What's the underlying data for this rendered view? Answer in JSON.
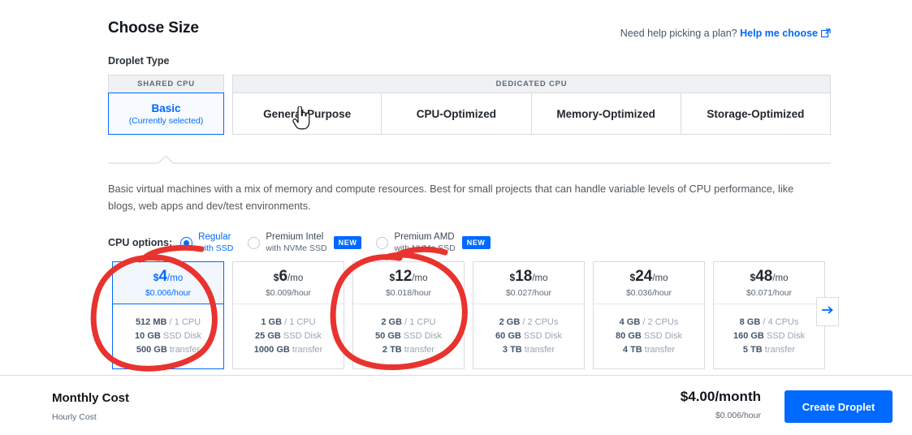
{
  "header": {
    "title": "Choose Size",
    "help_prefix": "Need help picking a plan?",
    "help_link": "Help me choose",
    "external_link_icon": "external-link-icon"
  },
  "droplet_type": {
    "label": "Droplet Type",
    "groups": [
      {
        "group_label": "SHARED CPU",
        "tabs": [
          {
            "label": "Basic",
            "sublabel": "(Currently selected)",
            "selected": true
          }
        ]
      },
      {
        "group_label": "DEDICATED CPU",
        "tabs": [
          {
            "label": "General Purpose",
            "sublabel": "",
            "selected": false
          },
          {
            "label": "CPU-Optimized",
            "sublabel": "",
            "selected": false
          },
          {
            "label": "Memory-Optimized",
            "sublabel": "",
            "selected": false
          },
          {
            "label": "Storage-Optimized",
            "sublabel": "",
            "selected": false
          }
        ]
      }
    ]
  },
  "description": "Basic virtual machines with a mix of memory and compute resources. Best for small projects that can handle variable levels of CPU performance, like blogs, web apps and dev/test environments.",
  "cpu_options": {
    "label": "CPU options:",
    "options": [
      {
        "title": "Regular",
        "subtitle": "with SSD",
        "selected": true,
        "badge": ""
      },
      {
        "title": "Premium Intel",
        "subtitle": "with NVMe SSD",
        "selected": false,
        "badge": "NEW"
      },
      {
        "title": "Premium AMD",
        "subtitle": "with NVMe SSD",
        "selected": false,
        "badge": "NEW"
      }
    ]
  },
  "plans": [
    {
      "price": "4",
      "currency": "$",
      "per": "/mo",
      "hourly": "$0.006/hour",
      "memory": "512 MB",
      "cpu": "1 CPU",
      "disk": "10 GB",
      "disk_label": "SSD Disk",
      "transfer": "500 GB",
      "transfer_label": "transfer",
      "selected": true
    },
    {
      "price": "6",
      "currency": "$",
      "per": "/mo",
      "hourly": "$0.009/hour",
      "memory": "1 GB",
      "cpu": "1 CPU",
      "disk": "25 GB",
      "disk_label": "SSD Disk",
      "transfer": "1000 GB",
      "transfer_label": "transfer",
      "selected": false
    },
    {
      "price": "12",
      "currency": "$",
      "per": "/mo",
      "hourly": "$0.018/hour",
      "memory": "2 GB",
      "cpu": "1 CPU",
      "disk": "50 GB",
      "disk_label": "SSD Disk",
      "transfer": "2 TB",
      "transfer_label": "transfer",
      "selected": false
    },
    {
      "price": "18",
      "currency": "$",
      "per": "/mo",
      "hourly": "$0.027/hour",
      "memory": "2 GB",
      "cpu": "2 CPUs",
      "disk": "60 GB",
      "disk_label": "SSD Disk",
      "transfer": "3 TB",
      "transfer_label": "transfer",
      "selected": false
    },
    {
      "price": "24",
      "currency": "$",
      "per": "/mo",
      "hourly": "$0.036/hour",
      "memory": "4 GB",
      "cpu": "2 CPUs",
      "disk": "80 GB",
      "disk_label": "SSD Disk",
      "transfer": "4 TB",
      "transfer_label": "transfer",
      "selected": false
    },
    {
      "price": "48",
      "currency": "$",
      "per": "/mo",
      "hourly": "$0.071/hour",
      "memory": "8 GB",
      "cpu": "4 CPUs",
      "disk": "160 GB",
      "disk_label": "SSD Disk",
      "transfer": "5 TB",
      "transfer_label": "transfer",
      "selected": false
    }
  ],
  "next_button_icon": "arrow-right-icon",
  "footer": {
    "monthly_label": "Monthly Cost",
    "hourly_label": "Hourly Cost",
    "monthly_cost": "$4.00/month",
    "hourly_cost": "$0.006/hour",
    "create_button": "Create Droplet"
  },
  "annotations": {
    "color": "#e8332e",
    "marks": [
      {
        "name": "circle-basic-4-plan"
      },
      {
        "name": "circle-12-plan"
      }
    ]
  },
  "colors": {
    "accent": "#0069ff",
    "annotation_red": "#e8332e",
    "border": "#d7dbe0",
    "text_dark": "#11161c",
    "text_muted": "#5c6a78"
  },
  "cursor": {
    "type": "pointer-hand-cursor"
  }
}
